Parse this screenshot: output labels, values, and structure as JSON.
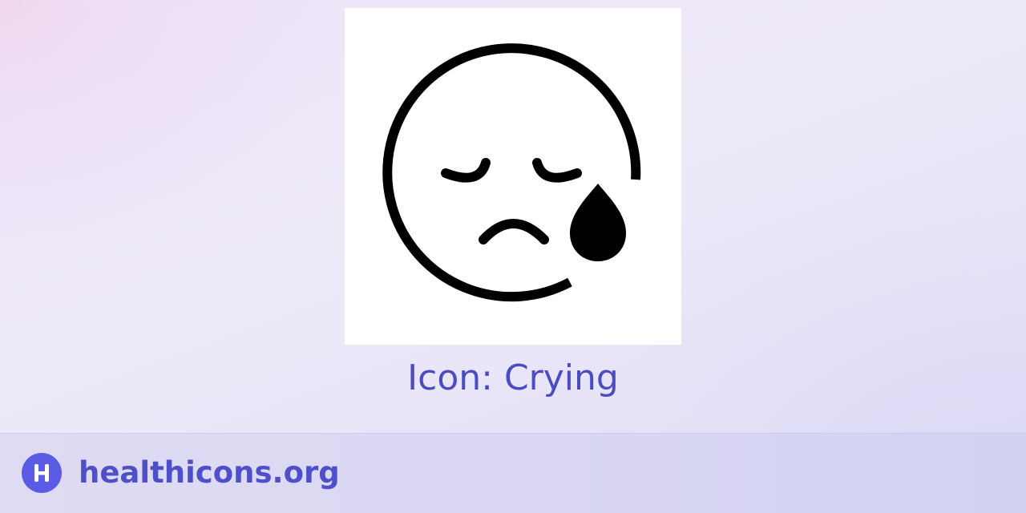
{
  "icon": {
    "name": "crying-face-icon",
    "color": "#000000",
    "card_color": "#ffffff"
  },
  "caption": {
    "text": "Icon: Crying",
    "color": "#4a4cc0"
  },
  "footer": {
    "logo_icon": "healthicons-logo-icon",
    "logo_color": "#5b5ce6",
    "site_name": "healthicons.org",
    "site_name_color": "#4f50c9"
  }
}
